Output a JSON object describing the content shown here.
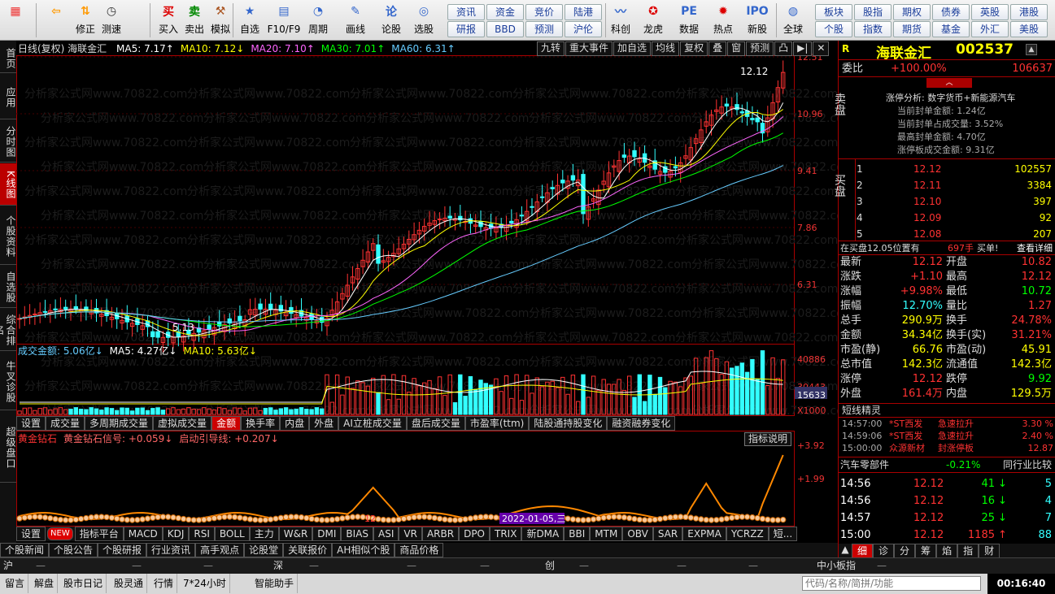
{
  "toolbar": {
    "big": [
      {
        "label": "",
        "icon": "windows-icon"
      },
      {
        "label": "",
        "icon": "back-arrow-icon"
      },
      {
        "label": "修正",
        "icon": "up-down-icon"
      },
      {
        "label": "测速",
        "icon": "clock-icon"
      },
      {
        "label": "买入",
        "icon": "buy-icon",
        "glyph": "买"
      },
      {
        "label": "卖出",
        "icon": "sell-icon",
        "glyph": "卖"
      },
      {
        "label": "模拟",
        "icon": "hammer-icon"
      },
      {
        "label": "自选",
        "icon": "star-icon"
      },
      {
        "label": "F10/F9",
        "icon": "f10-icon"
      },
      {
        "label": "周期",
        "icon": "cycle-icon"
      },
      {
        "label": "画线",
        "icon": "pen-icon"
      },
      {
        "label": "论股",
        "icon": "chat-icon",
        "glyph": "论"
      },
      {
        "label": "选股",
        "icon": "filter-icon"
      },
      {
        "label": "科创",
        "icon": "kc-icon"
      },
      {
        "label": "龙虎",
        "icon": "dragon-icon"
      },
      {
        "label": "数据",
        "icon": "pe-icon",
        "glyph": "PE"
      },
      {
        "label": "热点",
        "icon": "hot-icon"
      },
      {
        "label": "新股",
        "icon": "ipo-icon",
        "glyph": "IPO"
      },
      {
        "label": "全球",
        "icon": "globe-icon"
      }
    ],
    "small": [
      [
        "资讯",
        "资金",
        "竞价",
        "陆港"
      ],
      [
        "研报",
        "BBD",
        "预测",
        "沪伦"
      ],
      [
        "板块",
        "股指",
        "期权",
        "债券",
        "英股",
        "港股"
      ],
      [
        "个股",
        "指数",
        "期货",
        "基金",
        "外汇",
        "美股"
      ]
    ]
  },
  "left_tabs": [
    "首页",
    "应用",
    "分时图",
    "K线图",
    "个股资料",
    "自选股",
    "综合排名",
    "牛叉诊股",
    "超级盘口"
  ],
  "chart": {
    "title": "日线(复权)  海联金汇",
    "ma": [
      {
        "label": "MA5: 7.17↑",
        "color": "#ffffff"
      },
      {
        "label": "MA10: 7.12↓",
        "color": "#ffff00"
      },
      {
        "label": "MA20: 7.10↑",
        "color": "#ff66ff"
      },
      {
        "label": "MA30: 7.01↑",
        "color": "#00ff00"
      },
      {
        "label": "MA60: 6.31↑",
        "color": "#66ccff"
      }
    ],
    "top_buttons": [
      "九转",
      "重大事件",
      "加自选",
      "均线",
      "复权",
      "叠",
      "窗",
      "预测",
      "凸",
      "▶|",
      "✕"
    ],
    "price_axis": [
      "12.51",
      "10.96",
      "9.41",
      "7.86",
      "6.31"
    ],
    "high_label": "12.12",
    "low_label": "5.13",
    "watermark": "分析家公式网www.70822.com",
    "volume_header": [
      {
        "label": "成交金额: 5.06亿↓",
        "color": "#66ccff"
      },
      {
        "label": "MA5: 4.27亿↓",
        "color": "#ffffff"
      },
      {
        "label": "MA10: 5.63亿↓",
        "color": "#ffff00"
      }
    ],
    "vol_axis": [
      "40886",
      "30443",
      "15633",
      "X1000"
    ],
    "vol_tabs": [
      "设置",
      "成交量",
      "多周期成交量",
      "虚拟成交量",
      "金额",
      "换手率",
      "内盘",
      "外盘",
      "AI立桩成交量",
      "盘后成交量",
      "市盈率(ttm)",
      "陆股通持股变化",
      "融资融券变化"
    ],
    "vol_tab_active": 4,
    "indicator_header": [
      {
        "label": "黄金钻石",
        "color": "#ff3333"
      },
      {
        "label": "黄金钻石信号: +0.059↓",
        "color": "#ff6666"
      },
      {
        "label": "启动引导线: +0.207↓",
        "color": "#ff6666"
      }
    ],
    "ind_axis": [
      "+3.92",
      "+1.99"
    ],
    "ind_button": "指标说明",
    "ind_mark": "12",
    "date_label": "2022-01-05,三",
    "ind_tabs": [
      "设置",
      "NEW",
      "指标平台",
      "MACD",
      "KDJ",
      "RSI",
      "BOLL",
      "主力",
      "W&R",
      "DMI",
      "BIAS",
      "ASI",
      "VR",
      "ARBR",
      "DPO",
      "TRIX",
      "新DMA",
      "BBI",
      "MTM",
      "OBV",
      "SAR",
      "EXPMA",
      "YCRZZ",
      "短..."
    ]
  },
  "bottom_tabs": [
    "个股新闻",
    "个股公告",
    "个股研报",
    "行业资讯",
    "高手观点",
    "论股堂",
    "关联报价",
    "AH相似个股",
    "商品价格"
  ],
  "right": {
    "name": "海联金汇",
    "code": "002537",
    "r_label": "R",
    "webi_label": "委比",
    "webi_pct": "+100.00%",
    "webi_val": "106637",
    "sell_label": "卖盘",
    "limit_info": [
      "涨停分析: 数字货币+新能源汽车",
      "当前封单金额: 1.24亿",
      "当前封单占成交量: 3.52%",
      "最高封单金额: 4.70亿",
      "涨停板成交金额: 9.31亿"
    ],
    "buy_label": "买盘",
    "bids": [
      {
        "n": "1",
        "p": "12.12",
        "v": "102557"
      },
      {
        "n": "2",
        "p": "12.11",
        "v": "3384"
      },
      {
        "n": "3",
        "p": "12.10",
        "v": "397"
      },
      {
        "n": "4",
        "p": "12.09",
        "v": "92"
      },
      {
        "n": "5",
        "p": "12.08",
        "v": "207"
      }
    ],
    "bid_note": "在买盘12.05位置有",
    "bid_note_val": "697手",
    "bid_note_flag": "买单!",
    "bid_note_link": "查看详细",
    "quotes": [
      [
        "最新",
        "12.12",
        "开盘",
        "10.82"
      ],
      [
        "涨跌",
        "+1.10",
        "最高",
        "12.12"
      ],
      [
        "涨幅",
        "+9.98%",
        "最低",
        "10.72"
      ],
      [
        "振幅",
        "12.70%",
        "量比",
        "1.27"
      ],
      [
        "总手",
        "290.9万",
        "换手",
        "24.78%"
      ],
      [
        "金额",
        "34.34亿",
        "换手(实)",
        "31.21%"
      ],
      [
        "市盈(静)",
        "66.76",
        "市盈(动)",
        "45.91"
      ],
      [
        "总市值",
        "142.3亿",
        "流通值",
        "142.3亿"
      ],
      [
        "涨停",
        "12.12",
        "跌停",
        "9.92"
      ],
      [
        "外盘",
        "161.4万",
        "内盘",
        "129.5万"
      ]
    ],
    "short_title": "短线精灵",
    "short_list": [
      {
        "t": "14:57:00",
        "n": "*ST西发",
        "e": "急速拉升",
        "v": "3.30 %"
      },
      {
        "t": "14:59:06",
        "n": "*ST西发",
        "e": "急速拉升",
        "v": "2.40 %"
      },
      {
        "t": "15:00:00",
        "n": "众源新材",
        "e": "封涨停板",
        "v": "12.87"
      }
    ],
    "sector_name": "汽车零部件",
    "sector_pct": "-0.21%",
    "sector_btn": "同行业比较",
    "ticks": [
      {
        "t": "14:56",
        "p": "12.12",
        "v": "41",
        "a": "↓",
        "n": "5"
      },
      {
        "t": "14:56",
        "p": "12.12",
        "v": "16",
        "a": "↓",
        "n": "4"
      },
      {
        "t": "14:57",
        "p": "12.12",
        "v": "25",
        "a": "↓",
        "n": "7"
      },
      {
        "t": "15:00",
        "p": "12.12",
        "v": "1185",
        "a": "↑",
        "n": "88"
      }
    ],
    "tabs": [
      "细",
      "诊",
      "分",
      "筹",
      "焰",
      "指",
      "财"
    ]
  },
  "status": {
    "items": [
      "沪",
      "—",
      "—",
      "—",
      "深",
      "—",
      "—",
      "—",
      "创",
      "—",
      "—",
      "—",
      "中小板指",
      "—"
    ]
  },
  "status2": {
    "items": [
      "留言",
      "解盘",
      "股市日记",
      "股灵通",
      "行情",
      "7*24小时",
      "智能助手"
    ],
    "search_placeholder": "代码/名称/简拼/功能",
    "time": "00:16:40"
  }
}
